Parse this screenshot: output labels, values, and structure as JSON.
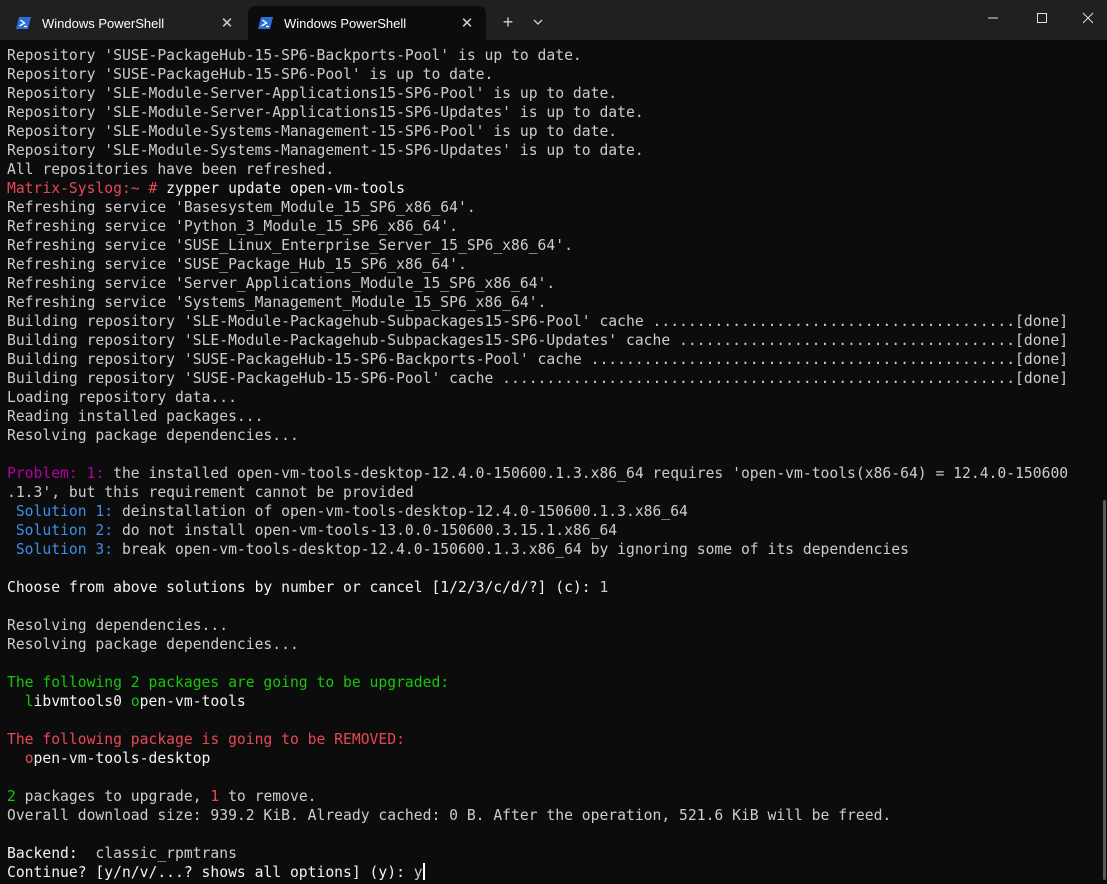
{
  "tabs": [
    {
      "label": "Windows PowerShell",
      "close": "✕"
    },
    {
      "label": "Windows PowerShell",
      "close": "✕"
    }
  ],
  "titlebar": {
    "newtab": "+",
    "minimize": "—",
    "maximize": "☐",
    "close": "✕"
  },
  "colors": {
    "prompt": "#e74856",
    "green": "#16c60c",
    "blue": "#3b8eea",
    "purple": "#b4009e",
    "text": "#cccccc",
    "bg": "#0c0c0c"
  },
  "terminal": {
    "l01": "Repository 'SUSE-PackageHub-15-SP6-Backports-Pool' is up to date.",
    "l02": "Repository 'SUSE-PackageHub-15-SP6-Pool' is up to date.",
    "l03": "Repository 'SLE-Module-Server-Applications15-SP6-Pool' is up to date.",
    "l04": "Repository 'SLE-Module-Server-Applications15-SP6-Updates' is up to date.",
    "l05": "Repository 'SLE-Module-Systems-Management-15-SP6-Pool' is up to date.",
    "l06": "Repository 'SLE-Module-Systems-Management-15-SP6-Updates' is up to date.",
    "l07": "All repositories have been refreshed.",
    "prompt": "Matrix-Syslog:~ #",
    "command": " zypper update open-vm-tools",
    "l09": "Refreshing service 'Basesystem_Module_15_SP6_x86_64'.",
    "l10": "Refreshing service 'Python_3_Module_15_SP6_x86_64'.",
    "l11": "Refreshing service 'SUSE_Linux_Enterprise_Server_15_SP6_x86_64'.",
    "l12": "Refreshing service 'SUSE_Package_Hub_15_SP6_x86_64'.",
    "l13": "Refreshing service 'Server_Applications_Module_15_SP6_x86_64'.",
    "l14": "Refreshing service 'Systems_Management_Module_15_SP6_x86_64'.",
    "l15": "Building repository 'SLE-Module-Packagehub-Subpackages15-SP6-Pool' cache .........................................[done]",
    "l16": "Building repository 'SLE-Module-Packagehub-Subpackages15-SP6-Updates' cache ......................................[done]",
    "l17": "Building repository 'SUSE-PackageHub-15-SP6-Backports-Pool' cache ................................................[done]",
    "l18": "Building repository 'SUSE-PackageHub-15-SP6-Pool' cache ..........................................................[done]",
    "l19": "Loading repository data...",
    "l20": "Reading installed packages...",
    "l21": "Resolving package dependencies...",
    "problem_label": "Problem: 1:",
    "problem_text": " the installed open-vm-tools-desktop-12.4.0-150600.1.3.x86_64 requires 'open-vm-tools(x86-64) = 12.4.0-150600",
    "problem_cont": ".1.3', but this requirement cannot be provided",
    "sol1_label": " Solution 1:",
    "sol1_text": " deinstallation of open-vm-tools-desktop-12.4.0-150600.1.3.x86_64",
    "sol2_label": " Solution 2:",
    "sol2_text": " do not install open-vm-tools-13.0.0-150600.3.15.1.x86_64",
    "sol3_label": " Solution 3:",
    "sol3_text": " break open-vm-tools-desktop-12.4.0-150600.1.3.x86_64 by ignoring some of its dependencies",
    "choose": "Choose from above solutions by number or cancel [1/2/3/c/d/?] (c):",
    "choose_answer": " 1",
    "l31": "Resolving dependencies...",
    "l32": "Resolving package dependencies...",
    "upgrade_header": "The following 2 packages are going to be upgraded:",
    "up_pkg1_first": "l",
    "up_pkg1_rest": "ibvmtools0 ",
    "up_pkg2_first": "o",
    "up_pkg2_rest": "pen-vm-tools",
    "remove_header": "The following package is going to be REMOVED:",
    "rm_pkg_first": "o",
    "rm_pkg_rest": "pen-vm-tools-desktop",
    "summary_n1": "2",
    "summary_mid": " packages to upgrade, ",
    "summary_n2": "1",
    "summary_end": " to remove.",
    "download": "Overall download size: 939.2 KiB. Already cached: 0 B. After the operation, 521.6 KiB will be freed.",
    "backend_label": "Backend:",
    "backend_value": "  classic_rpmtrans",
    "continue_prompt": "Continue? [y/n/v/...? shows all options] (y):",
    "continue_answer": " y"
  }
}
